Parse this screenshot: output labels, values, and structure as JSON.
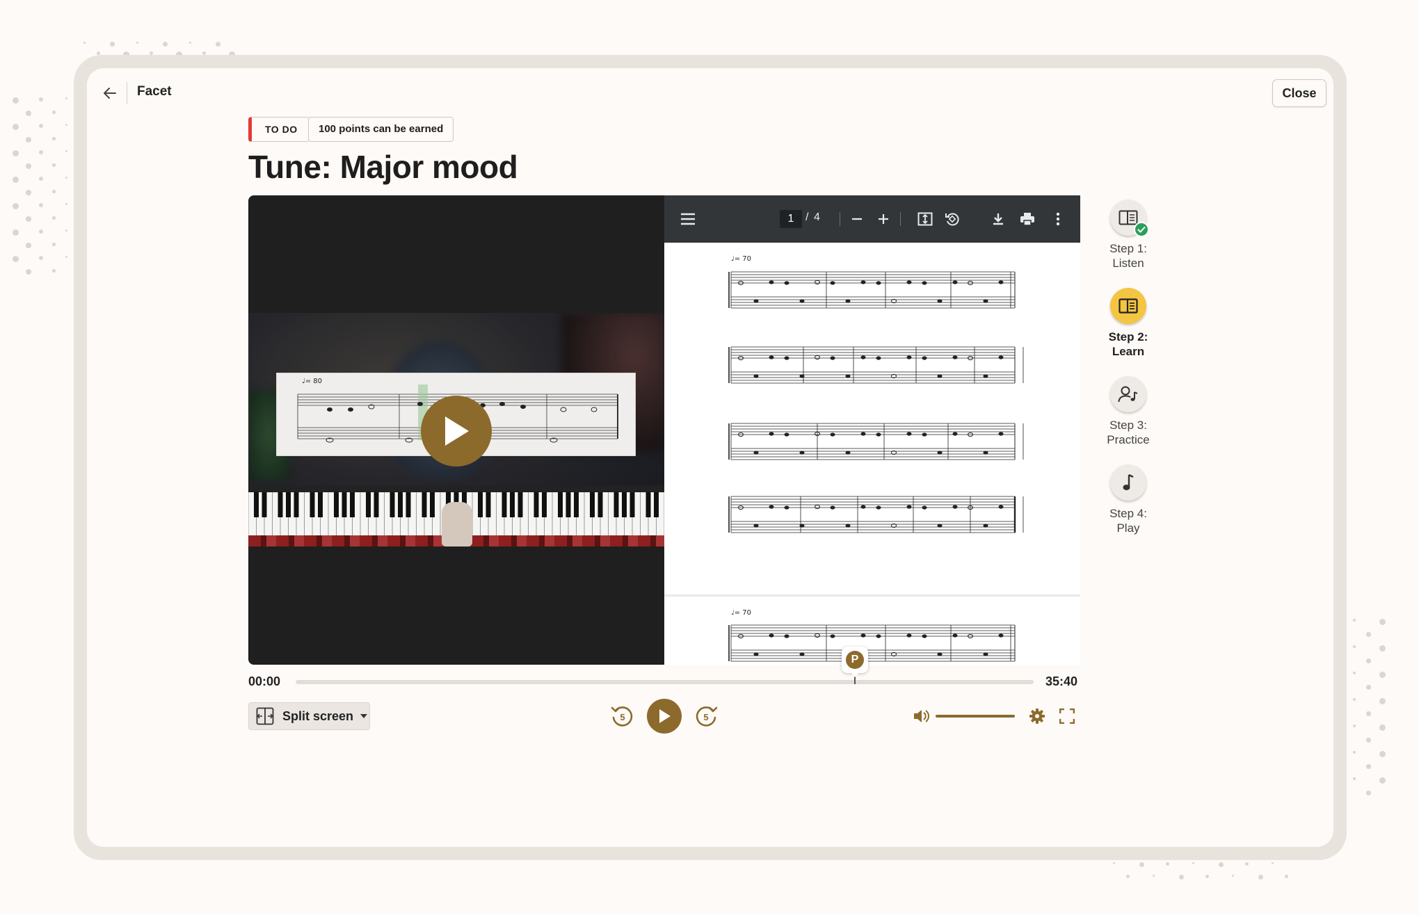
{
  "header": {
    "app_title": "Facet",
    "close_label": "Close"
  },
  "lesson": {
    "status_tag": "TO DO",
    "points_tag": "100 points can be earned",
    "title": "Tune: Major mood"
  },
  "pdf_viewer": {
    "current_page": "1",
    "page_separator": "/",
    "total_pages": "4",
    "tempo_marking": "♩= 70",
    "icons": [
      "menu-icon",
      "zoom-out-icon",
      "zoom-in-icon",
      "fit-page-icon",
      "rotate-icon",
      "download-icon",
      "print-icon",
      "more-vert-icon"
    ]
  },
  "video": {
    "tempo_marking": "♩= 80"
  },
  "playback": {
    "time_current": "00:00",
    "time_total": "35:40",
    "marker_label": "P",
    "layout_label": "Split screen",
    "skip_seconds": "5"
  },
  "steps": [
    {
      "label_line1": "Step 1:",
      "label_line2": "Listen",
      "state": "completed"
    },
    {
      "label_line1": "Step 2:",
      "label_line2": "Learn",
      "state": "active"
    },
    {
      "label_line1": "Step 3:",
      "label_line2": "Practice",
      "state": "upcoming"
    },
    {
      "label_line1": "Step 4:",
      "label_line2": "Play",
      "state": "upcoming"
    }
  ],
  "colors": {
    "accent_brown": "#8c6a2c",
    "active_step_yellow": "#f4c542",
    "todo_red": "#e53935",
    "check_green": "#2e9e5b"
  }
}
